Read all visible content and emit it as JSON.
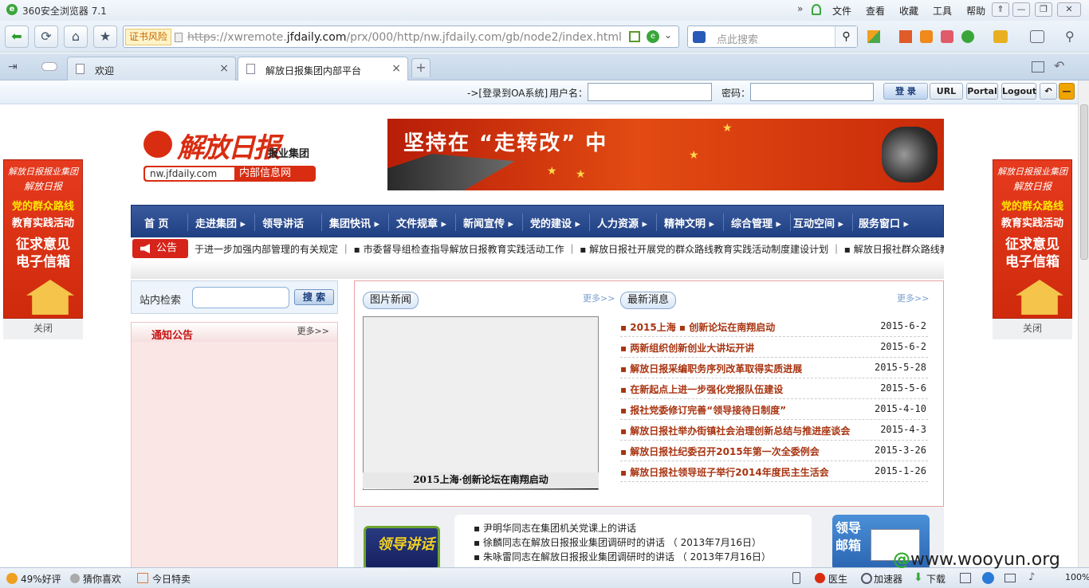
{
  "browser": {
    "title": "360安全浏览器 7.1",
    "menus": [
      "文件",
      "查看",
      "收藏",
      "工具",
      "帮助"
    ],
    "cert_warning": "证书风险",
    "url_scheme": "https",
    "url_prefix": "://xwremote.",
    "url_domain": "jfdaily.com",
    "url_rest": "/prx/000/http/nw.jfdaily.com/gb/node2/index.html",
    "search_placeholder": "点此搜索",
    "tabs": [
      {
        "label": "欢迎"
      },
      {
        "label": "解放日报集团内部平台"
      }
    ],
    "zoom": "100%"
  },
  "loginbar": {
    "prompt": "->[登录到OA系统]",
    "username_label": "用户名：",
    "password_label": "密码：",
    "login_button": "登 录",
    "url_button": "URL",
    "portal_button": "Portal",
    "logout_button": "Logout"
  },
  "side_ads": {
    "line1": "解放日报报业集团",
    "line2": "解放日报",
    "line3": "党的群众路线",
    "line4": "教育实践活动",
    "line5": "征求意见",
    "line6": "电子信箱",
    "close_label": "关闭"
  },
  "header": {
    "logo_cn": "解放日报",
    "logo_group": "报业集团",
    "logo_url": "nw.jfdaily.com",
    "logo_tag": "内部信息网",
    "banner_text": "坚持在 “走转改” 中"
  },
  "nav": {
    "items": [
      "首 页",
      "走进集团",
      "领导讲话",
      "集团快讯",
      "文件规章",
      "新闻宣传",
      "党的建设",
      "人力资源",
      "精神文明",
      "综合管理",
      "互动空间",
      "服务窗口"
    ]
  },
  "announcement": {
    "label": "公告",
    "text": "于进一步加强内部管理的有关规定  ｜  ▪ 市委督导组检查指导解放日报教育实践活动工作  ｜  ▪ 解放日报社开展党的群众路线教育实践活动制度建设计划  ｜  ▪ 解放日报社群众路线教"
  },
  "site_search": {
    "label": "站内检索",
    "button": "搜 索"
  },
  "notice": {
    "title": "通知公告",
    "more": "更多>>"
  },
  "photo_news": {
    "title": "图片新闻",
    "more": "更多>>",
    "caption": "2015上海·创新论坛在南翔启动"
  },
  "latest_news": {
    "title": "最新消息",
    "more": "更多>>",
    "items": [
      {
        "title": "▪ 2015上海 ▪ 创新论坛在南翔启动",
        "date": "2015-6-2"
      },
      {
        "title": "▪ 两新组织创新创业大讲坛开讲",
        "date": "2015-6-2"
      },
      {
        "title": "▪ 解放日报采编职务序列改革取得实质进展",
        "date": "2015-5-28"
      },
      {
        "title": "▪ 在新起点上进一步强化党报队伍建设",
        "date": "2015-5-6"
      },
      {
        "title": "▪ 报社党委修订完善“领导接待日制度”",
        "date": "2015-4-10"
      },
      {
        "title": "▪ 解放日报社举办街镇社会治理创新总结与推进座谈会",
        "date": "2015-4-3"
      },
      {
        "title": "▪ 解放日报社纪委召开2015年第一次全委例会",
        "date": "2015-3-26"
      },
      {
        "title": "▪ 解放日报社领导班子举行2014年度民主生活会",
        "date": "2015-1-26"
      }
    ]
  },
  "leader_talks": {
    "tv_label": "领导讲话",
    "items": [
      "▪ 尹明华同志在集团机关党课上的讲话",
      "▪ 徐麟同志在解放日报报业集团调研时的讲话  （ 2013年7月16日）",
      "▪ 朱咏雷同志在解放日报报业集团调研时的讲话  （ 2013年7月16日）"
    ],
    "mailbox_label": "领导邮箱"
  },
  "statusbar": {
    "rating": "49%好评",
    "guess": "猜你喜欢",
    "deals": "今日特卖",
    "doctor": "医生",
    "accelerator": "加速器",
    "download": "下载"
  },
  "watermark": "www.wooyun.org"
}
